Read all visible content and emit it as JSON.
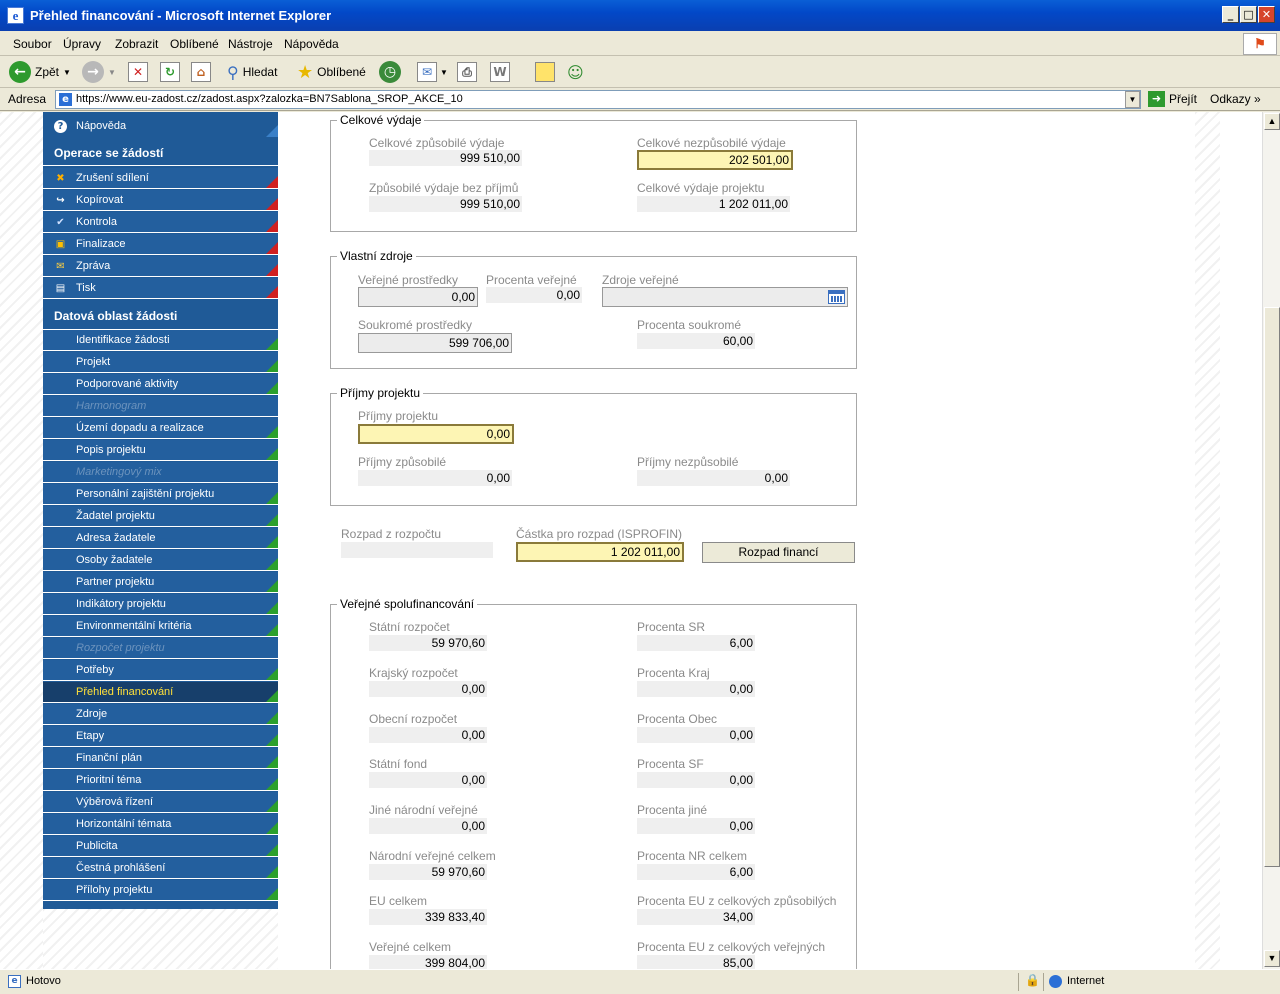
{
  "window": {
    "title": "Přehled financování - Microsoft Internet Explorer",
    "controls": [
      "_",
      "□",
      "✕"
    ]
  },
  "menu": [
    "Soubor",
    "Úpravy",
    "Zobrazit",
    "Oblíbené",
    "Nástroje",
    "Nápověda"
  ],
  "toolbar": {
    "back": "Zpět",
    "search": "Hledat",
    "favorites": "Oblíbené"
  },
  "address": {
    "label": "Adresa",
    "url": "https://www.eu-zadost.cz/zadost.aspx?zalozka=BN7Sablona_SROP_AKCE_10",
    "go": "Přejít",
    "links": "Odkazy"
  },
  "sidebar": {
    "help": "Nápověda",
    "ops_head": "Operace se žádostí",
    "ops": [
      "Zrušení sdílení",
      "Kopírovat",
      "Kontrola",
      "Finalizace",
      "Zpráva",
      "Tisk"
    ],
    "data_head": "Datová oblast žádosti",
    "items": [
      "Identifikace žádosti",
      "Projekt",
      "Podporované aktivity",
      "Harmonogram",
      "Území dopadu a realizace",
      "Popis projektu",
      "Marketingový mix",
      "Personální zajištění projektu",
      "Žadatel projektu",
      "Adresa žadatele",
      "Osoby žadatele",
      "Partner projektu",
      "Indikátory projektu",
      "Environmentální kritéria",
      "Rozpočet projektu",
      "Potřeby",
      "Přehled financování",
      "Zdroje",
      "Etapy",
      "Finanční plán",
      "Prioritní téma",
      "Výběrová řízení",
      "Horizontální témata",
      "Publicita",
      "Čestná prohlášení",
      "Přílohy projektu"
    ]
  },
  "celkove": {
    "legend": "Celkové výdaje",
    "zpusobile_lbl": "Celkové způsobilé výdaje",
    "zpusobile": "999 510,00",
    "nezpusobile_lbl": "Celkové nezpůsobilé výdaje",
    "nezpusobile": "202 501,00",
    "bez_prijmu_lbl": "Způsobilé výdaje bez příjmů",
    "bez_prijmu": "999 510,00",
    "projektu_lbl": "Celkové výdaje projektu",
    "projektu": "1 202 011,00"
  },
  "vlastni": {
    "legend": "Vlastní zdroje",
    "verejne_lbl": "Veřejné prostředky",
    "verejne": "0,00",
    "proc_verejne_lbl": "Procenta veřejné",
    "proc_verejne": "0,00",
    "zdroje_lbl": "Zdroje veřejné",
    "zdroje": "",
    "soukrome_lbl": "Soukromé prostředky",
    "soukrome": "599 706,00",
    "proc_soukrome_lbl": "Procenta soukromé",
    "proc_soukrome": "60,00"
  },
  "prijmy": {
    "legend": "Příjmy projektu",
    "projektu_lbl": "Příjmy projektu",
    "projektu": "0,00",
    "zpusobile_lbl": "Příjmy způsobilé",
    "zpusobile": "0,00",
    "nezpusobile_lbl": "Příjmy nezpůsobilé",
    "nezpusobile": "0,00"
  },
  "rozpad": {
    "z_rozpoctu_lbl": "Rozpad z rozpočtu",
    "z_rozpoctu": "",
    "castka_lbl": "Částka pro rozpad (ISPROFIN)",
    "castka": "1 202 011,00",
    "button": "Rozpad financí"
  },
  "spolufin": {
    "legend": "Veřejné spolufinancování",
    "rows": [
      {
        "l_lbl": "Státní rozpočet",
        "l": "59 970,60",
        "r_lbl": "Procenta SR",
        "r": "6,00"
      },
      {
        "l_lbl": "Krajský rozpočet",
        "l": "0,00",
        "r_lbl": "Procenta Kraj",
        "r": "0,00"
      },
      {
        "l_lbl": "Obecní rozpočet",
        "l": "0,00",
        "r_lbl": "Procenta Obec",
        "r": "0,00"
      },
      {
        "l_lbl": "Státní fond",
        "l": "0,00",
        "r_lbl": "Procenta SF",
        "r": "0,00"
      },
      {
        "l_lbl": "Jiné národní veřejné",
        "l": "0,00",
        "r_lbl": "Procenta jiné",
        "r": "0,00"
      },
      {
        "l_lbl": "Národní veřejné celkem",
        "l": "59 970,60",
        "r_lbl": "Procenta NR celkem",
        "r": "6,00"
      },
      {
        "l_lbl": "EU celkem",
        "l": "339 833,40",
        "r_lbl": "Procenta EU z celkových způsobilých",
        "r": "34,00"
      },
      {
        "l_lbl": "Veřejné celkem",
        "l": "399 804,00",
        "r_lbl": "Procenta EU z celkových veřejných",
        "r": "85,00"
      }
    ]
  },
  "status": {
    "text": "Hotovo",
    "zone": "Internet"
  }
}
